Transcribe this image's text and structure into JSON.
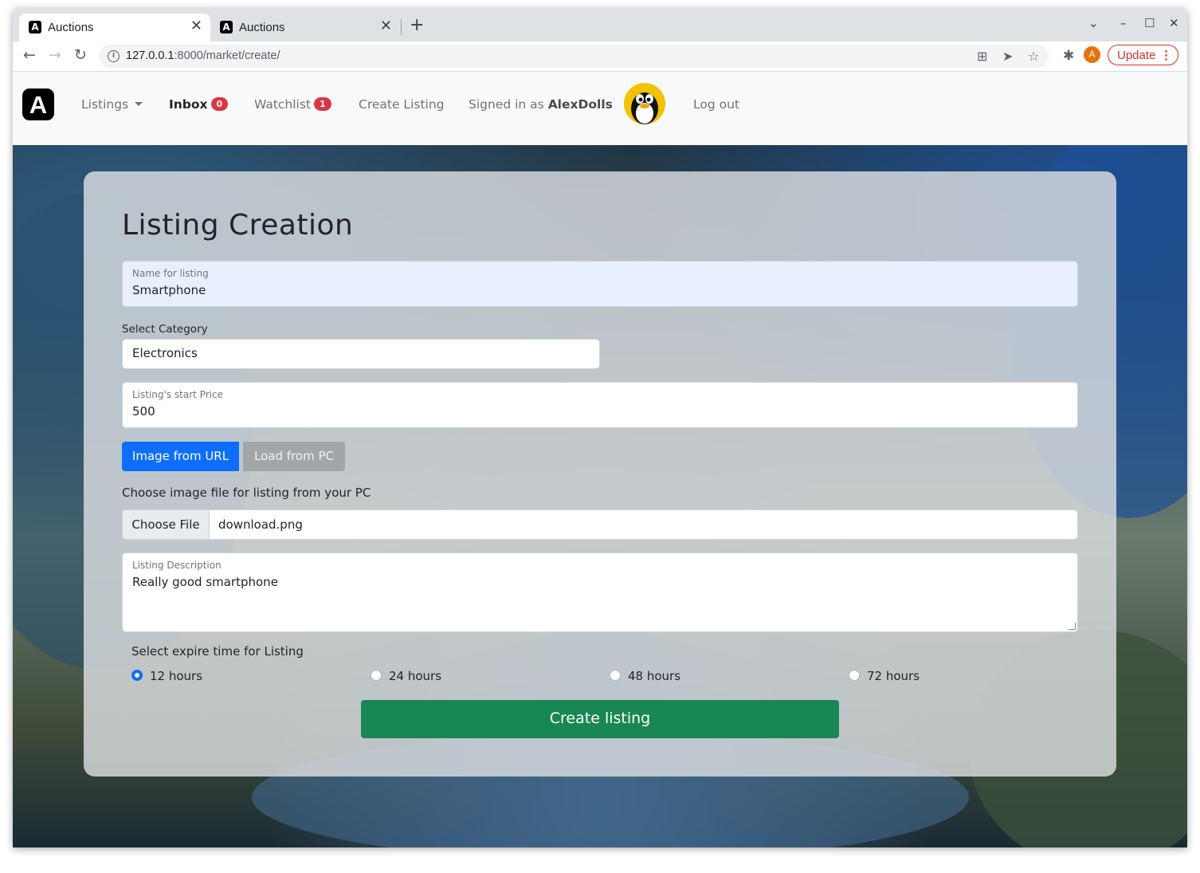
{
  "browser": {
    "tabs": [
      {
        "title": "Auctions",
        "favicon": "A"
      },
      {
        "title": "Auctions",
        "favicon": "A"
      }
    ],
    "url_host": "127.0.0.1",
    "url_rest": ":8000/market/create/",
    "profile_initial": "A",
    "update_label": "Update"
  },
  "navbar": {
    "brand": "A",
    "listings": "Listings",
    "inbox": "Inbox",
    "inbox_count": "0",
    "watchlist": "Watchlist",
    "watchlist_count": "1",
    "create_listing": "Create Listing",
    "signed_in_prefix": "Signed in as",
    "username": "AlexDolls",
    "logout": "Log out"
  },
  "form": {
    "heading": "Listing Creation",
    "name_label": "Name for listing",
    "name_value": "Smartphone",
    "category_label": "Select Category",
    "category_value": "Electronics",
    "price_label": "Listing's start Price",
    "price_value": "500",
    "image_url_btn": "Image from URL",
    "load_pc_btn": "Load from PC",
    "file_label": "Choose image file for listing from your PC",
    "choose_file": "Choose File",
    "file_name": "download.png",
    "description_label": "Listing Description",
    "description_value": "Really good smartphone",
    "expire_label": "Select expire time for Listing",
    "expire_options": [
      "12 hours",
      "24 hours",
      "48 hours",
      "72 hours"
    ],
    "expire_selected": "12 hours",
    "submit": "Create listing"
  },
  "colors": {
    "primary": "#0d6efd",
    "success": "#198754",
    "badge": "#dc3545"
  }
}
